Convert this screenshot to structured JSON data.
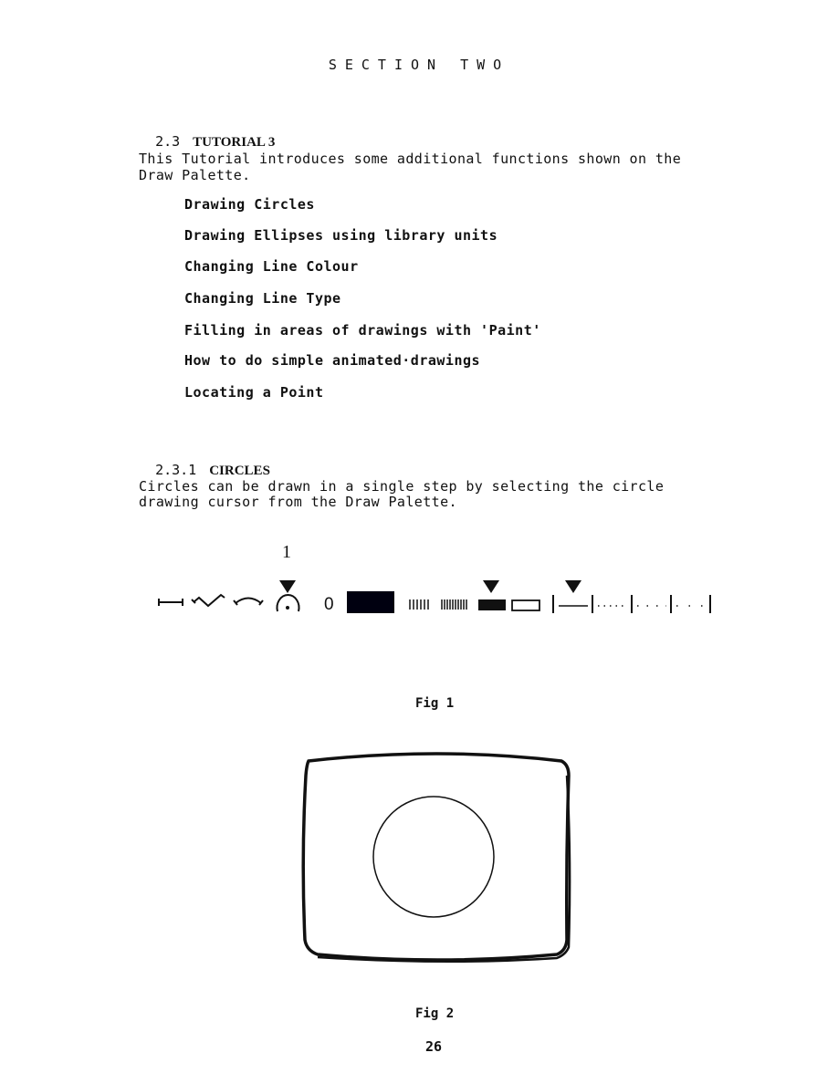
{
  "section_title": "SECTION TWO",
  "heading_2_3": {
    "number": "2.3",
    "title": "TUTORIAL 3"
  },
  "intro": {
    "line1": "This Tutorial introduces some additional functions shown on the",
    "line2": "Draw Palette."
  },
  "topics": [
    "Drawing Circles",
    "Drawing Ellipses using library units",
    "Changing Line Colour",
    "Changing Line Type",
    "Filling in areas of drawings with 'Paint'",
    "How to do simple animated·drawings",
    "Locating a Point"
  ],
  "heading_2_3_1": {
    "number": "2.3.1",
    "title": "CIRCLES"
  },
  "circles_text": {
    "line1": "Circles can be drawn in a single step by selecting the circle",
    "line2": "drawing cursor from the Draw Palette."
  },
  "palette": {
    "callout_number": "1",
    "colour_label": "0",
    "tools": [
      "line-tool-icon",
      "curve-tool-icon",
      "arc-tool-icon",
      "circle-tool-icon"
    ],
    "selected_tool": "circle-tool-icon",
    "selected_fill": "solid-fill",
    "selected_line_type": "solid-line",
    "colour_swatch": "#000010"
  },
  "figure1_caption": "Fig 1",
  "figure2_caption": "Fig 2",
  "page_number": "26"
}
